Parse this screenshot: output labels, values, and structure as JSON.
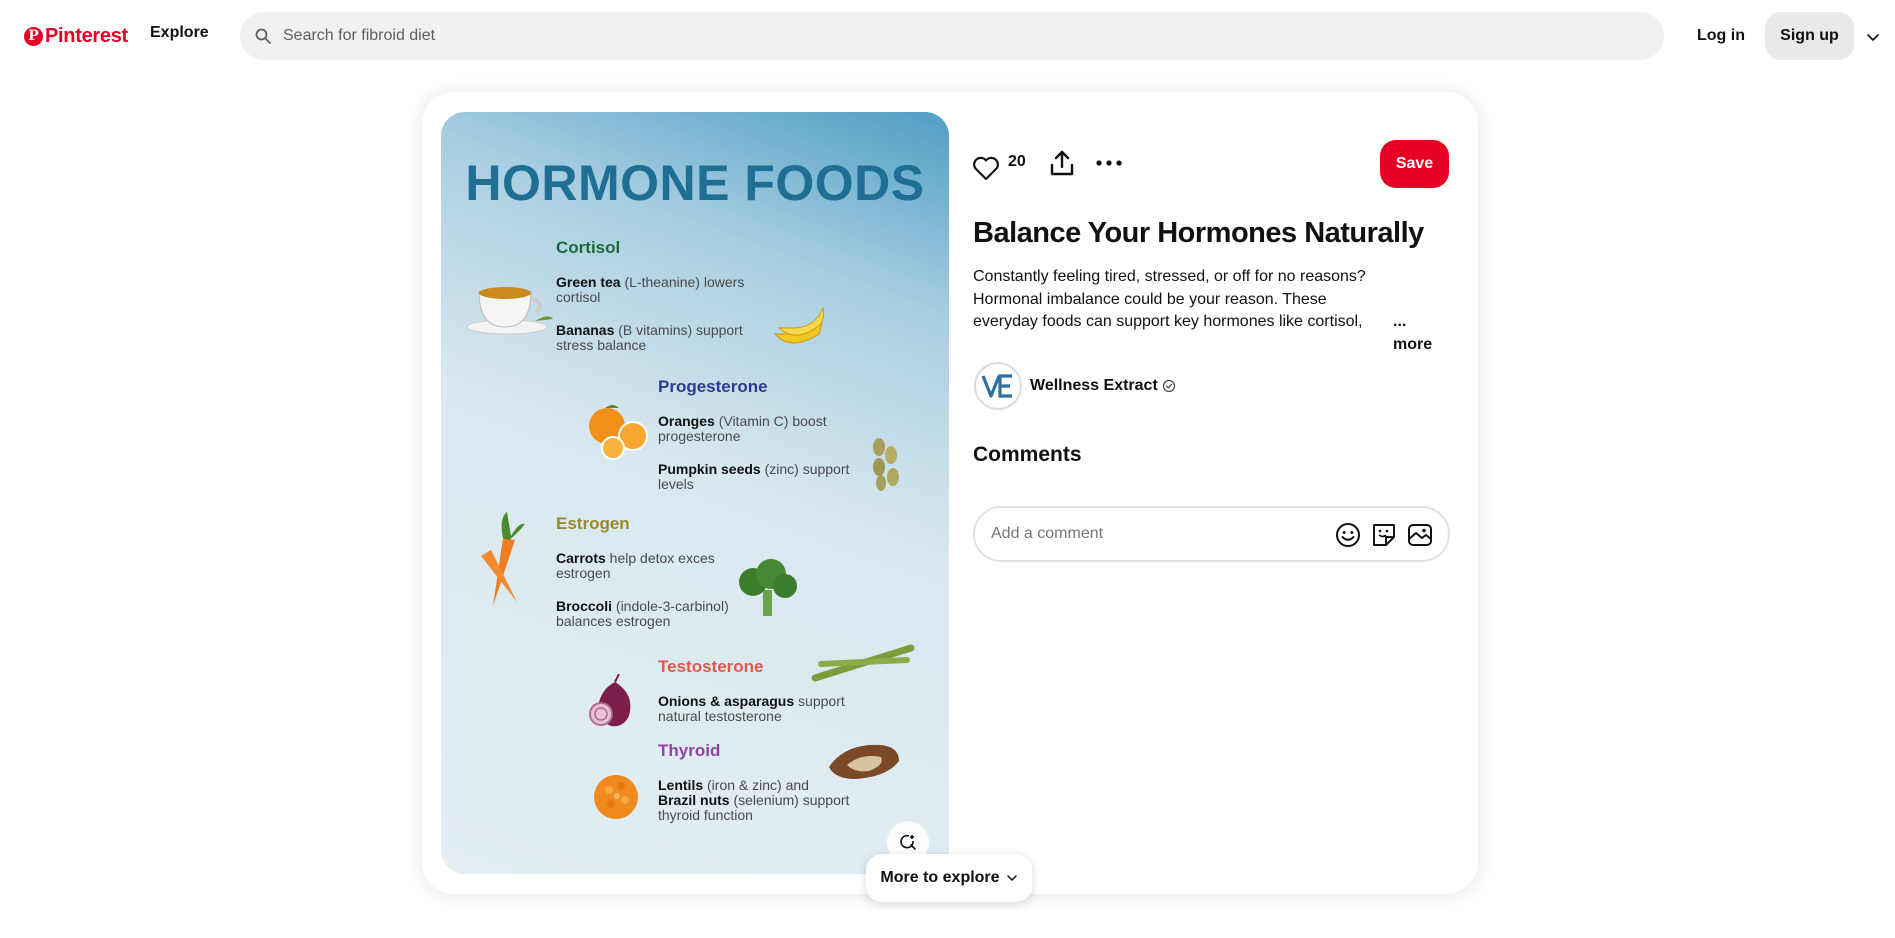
{
  "header": {
    "logo_text": "Pinterest",
    "explore_label": "Explore",
    "search_placeholder": "Search for fibroid diet",
    "login_label": "Log in",
    "signup_label": "Sign up"
  },
  "pin": {
    "image": {
      "title": "HORMONE FOODS",
      "sections": [
        {
          "heading": "Cortisol",
          "color": "#1e6b3a",
          "lines": [
            {
              "bold": "Green tea",
              "rest": " (L-theanine) lowers",
              "line2": "cortisol"
            },
            {
              "bold": "Bananas",
              "rest": " (B vitamins) support",
              "line2": "stress balance"
            }
          ]
        },
        {
          "heading": "Progesterone",
          "color": "#2d3c8c",
          "lines": [
            {
              "bold": "Oranges",
              "rest": " (Vitamin C) boost",
              "line2": "progesterone"
            },
            {
              "bold": "Pumpkin seeds",
              "rest": " (zinc) support",
              "line2": "levels"
            }
          ]
        },
        {
          "heading": "Estrogen",
          "color": "#9a8a2a",
          "lines": [
            {
              "bold": "Carrots",
              "rest": " help detox exces",
              "line2": "estrogen"
            },
            {
              "bold": "Broccoli",
              "rest": " (indole-3-carbinol)",
              "line2": "balances estrogen"
            }
          ]
        },
        {
          "heading": "Testosterone",
          "color": "#e2574c",
          "lines": [
            {
              "bold": "Onions & asparagus",
              "rest": " support",
              "line2": "natural testosterone"
            }
          ]
        },
        {
          "heading": "Thyroid",
          "color": "#8e44a0",
          "lines": [
            {
              "bold": "Lentils",
              "rest": " (iron & zinc) and",
              "line2": ""
            },
            {
              "bold": "Brazil nuts",
              "rest": " (selenium) support",
              "line2": "thyroid function"
            }
          ]
        }
      ]
    },
    "like_count": "20",
    "save_label": "Save",
    "title": "Balance Your Hormones Naturally",
    "description": "Constantly feeling tired, stressed, or off for no reasons? Hormonal imbalance could be your reason. These everyday foods can support key hormones like cortisol, progesterc",
    "more_label": "... more",
    "author": {
      "name": "Wellness Extract",
      "avatar_initials": "VE"
    },
    "comments_heading": "Comments",
    "comment_placeholder": "Add a comment",
    "more_to_explore_label": "More to explore"
  },
  "colors": {
    "brand": "#e60023",
    "search_bg": "#f1f1f1",
    "signup_bg": "#e9e9e9",
    "image_title": "#1f6f95"
  }
}
